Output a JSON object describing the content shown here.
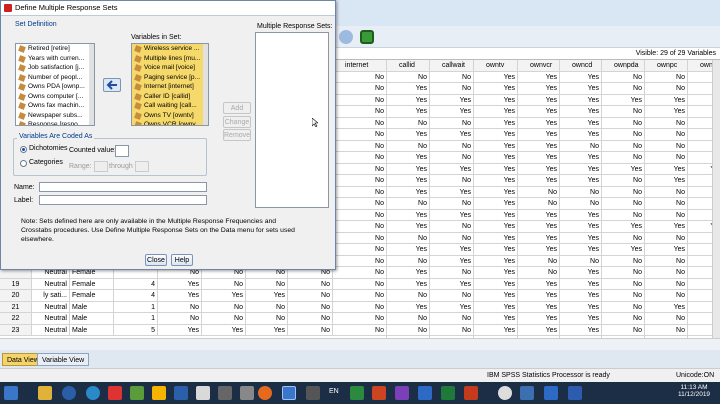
{
  "dialog": {
    "title": "Define Multiple Response Sets",
    "set_definition": "Set Definition",
    "variables_in_set_label": "Variables in Set:",
    "mr_sets_label": "Multiple Response Sets:",
    "source_vars": [
      "Retired [retire]",
      "Years with curren...",
      "Job satisfaction [j...",
      "Number of peopl...",
      "Owns PDA [ownp...",
      "Owns computer [...",
      "Owns fax machin...",
      "Newspaper subs...",
      "Response [respo..."
    ],
    "set_vars": [
      "Wireless service ...",
      "Multiple lines [mu...",
      "Voice mail [voice]",
      "Paging service [p...",
      "Internet [internet]",
      "Caller ID [callid]",
      "Call waiting [call...",
      "Owns TV [owntv]",
      "Owns VCR [ownv..."
    ],
    "add": "Add",
    "change": "Change",
    "remove": "Remove",
    "coded_as": "Variables Are Coded As",
    "dichotomies": "Dichotomies",
    "counted_value": "Counted value:",
    "categories": "Categories",
    "range": "Range:",
    "through": "through",
    "name_label": "Name:",
    "label_label": "Label:",
    "note": "Note: Sets defined here are only available in the Multiple Response Frequencies and Crosstabs procedures. Use Define Multiple Response Sets on the Data menu for sets used elsewhere.",
    "close": "Close",
    "help": "Help"
  },
  "grid": {
    "visible_text": "Visible: 29 of 29 Variables",
    "headers": [
      "internet",
      "callid",
      "callwait",
      "owntv",
      "ownvcr",
      "owncd",
      "ownpda",
      "ownpc",
      "ownfa"
    ],
    "rows": [
      [
        "No",
        "No",
        "No",
        "Yes",
        "Yes",
        "Yes",
        "No",
        "No",
        ""
      ],
      [
        "No",
        "Yes",
        "No",
        "Yes",
        "Yes",
        "Yes",
        "No",
        "No",
        ""
      ],
      [
        "No",
        "Yes",
        "Yes",
        "Yes",
        "Yes",
        "Yes",
        "Yes",
        "Yes",
        ""
      ],
      [
        "No",
        "Yes",
        "Yes",
        "Yes",
        "Yes",
        "Yes",
        "No",
        "Yes",
        ""
      ],
      [
        "No",
        "No",
        "No",
        "Yes",
        "Yes",
        "Yes",
        "No",
        "No",
        ""
      ],
      [
        "No",
        "Yes",
        "Yes",
        "Yes",
        "Yes",
        "Yes",
        "No",
        "No",
        ""
      ],
      [
        "No",
        "No",
        "No",
        "Yes",
        "Yes",
        "No",
        "No",
        "No",
        ""
      ],
      [
        "No",
        "Yes",
        "No",
        "Yes",
        "Yes",
        "Yes",
        "No",
        "No",
        ""
      ],
      [
        "No",
        "Yes",
        "Yes",
        "Yes",
        "Yes",
        "Yes",
        "Yes",
        "Yes",
        "Y"
      ],
      [
        "No",
        "Yes",
        "No",
        "Yes",
        "Yes",
        "Yes",
        "No",
        "Yes",
        ""
      ],
      [
        "No",
        "Yes",
        "Yes",
        "Yes",
        "No",
        "No",
        "No",
        "No",
        ""
      ],
      [
        "No",
        "No",
        "No",
        "Yes",
        "No",
        "No",
        "No",
        "No",
        ""
      ],
      [
        "No",
        "Yes",
        "Yes",
        "Yes",
        "Yes",
        "Yes",
        "No",
        "No",
        ""
      ],
      [
        "No",
        "Yes",
        "No",
        "Yes",
        "Yes",
        "Yes",
        "Yes",
        "Yes",
        "Y"
      ],
      [
        "No",
        "No",
        "No",
        "Yes",
        "Yes",
        "Yes",
        "No",
        "No",
        ""
      ],
      [
        "No",
        "Yes",
        "Yes",
        "Yes",
        "Yes",
        "Yes",
        "Yes",
        "Yes",
        ""
      ],
      [
        "No",
        "No",
        "Yes",
        "Yes",
        "No",
        "No",
        "No",
        "No",
        ""
      ],
      [
        "No",
        "Yes",
        "No",
        "Yes",
        "No",
        "Yes",
        "No",
        "No",
        ""
      ],
      [
        "No",
        "Yes",
        "Yes",
        "Yes",
        "Yes",
        "Yes",
        "No",
        "No",
        ""
      ],
      [
        "No",
        "No",
        "No",
        "Yes",
        "Yes",
        "Yes",
        "No",
        "No",
        ""
      ],
      [
        "No",
        "Yes",
        "Yes",
        "Yes",
        "Yes",
        "Yes",
        "No",
        "Yes",
        ""
      ],
      [
        "No",
        "No",
        "No",
        "Yes",
        "Yes",
        "Yes",
        "No",
        "No",
        ""
      ],
      [
        "No",
        "No",
        "No",
        "Yes",
        "Yes",
        "Yes",
        "No",
        "No",
        ""
      ],
      [
        "No",
        "Yes",
        "Yes",
        "Yes",
        "Yes",
        "Yes",
        "Yes",
        "Yes",
        "Y"
      ]
    ],
    "left_rows": [
      {
        "num": "",
        "a": "Neutral",
        "b": "Female",
        "c": "",
        "d": "No",
        "e": "No",
        "f": "No",
        "g": "No"
      },
      {
        "num": "19",
        "a": "Neutral",
        "b": "Female",
        "c": "4",
        "d": "Yes",
        "e": "No",
        "f": "No",
        "g": "No"
      },
      {
        "num": "20",
        "a": "ly sati...",
        "b": "Female",
        "c": "4",
        "d": "Yes",
        "e": "Yes",
        "f": "Yes",
        "g": "No"
      },
      {
        "num": "21",
        "a": "Neutral",
        "b": "Male",
        "c": "1",
        "d": "No",
        "e": "No",
        "f": "No",
        "g": "No"
      },
      {
        "num": "22",
        "a": "Neutral",
        "b": "Male",
        "c": "1",
        "d": "No",
        "e": "No",
        "f": "No",
        "g": "No"
      },
      {
        "num": "23",
        "a": "Neutral",
        "b": "Male",
        "c": "5",
        "d": "Yes",
        "e": "Yes",
        "f": "Yes",
        "g": "No"
      }
    ]
  },
  "tabs": {
    "data_view": "Data View",
    "variable_view": "Variable View"
  },
  "status": {
    "processor": "IBM SPSS Statistics Processor is ready",
    "unicode": "Unicode:ON"
  },
  "taskbar": {
    "time": "11:13 AM",
    "date": "11/12/2019",
    "lang": "EN"
  }
}
